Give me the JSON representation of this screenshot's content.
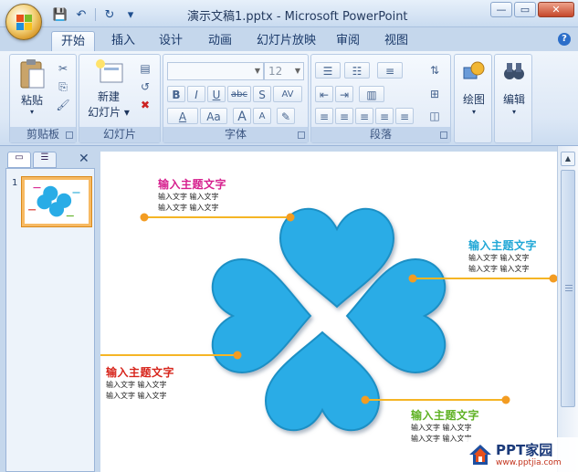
{
  "window": {
    "title": "演示文稿1.pptx - Microsoft PowerPoint",
    "buttons": {
      "minimize": "—",
      "restore": "▭",
      "close": "✕"
    }
  },
  "qat": {
    "save": "💾",
    "undo": "↶",
    "redo": "↻",
    "more": "▾"
  },
  "tabs": [
    "开始",
    "插入",
    "设计",
    "动画",
    "幻灯片放映",
    "审阅",
    "视图"
  ],
  "help": "?",
  "ribbon": {
    "clipboard": {
      "label": "剪贴板",
      "paste": "粘贴",
      "paste_arrow": "▾",
      "cut": "✂",
      "copy": "⎘",
      "format_painter": "🖌"
    },
    "slides": {
      "label": "幻灯片",
      "new_slide_1": "新建",
      "new_slide_2": "幻灯片 ▾",
      "layout": "▤",
      "reset": "↺",
      "delete": "✖"
    },
    "font": {
      "label": "字体",
      "font_name": "",
      "font_size": "12",
      "bold": "B",
      "italic": "I",
      "underline": "U",
      "strike": "abc",
      "shadow": "S",
      "spacing": "AV",
      "font_color": "A",
      "change_case": "Aa",
      "grow": "A",
      "shrink": "A",
      "clear": "✎"
    },
    "paragraph": {
      "label": "段落",
      "bullets": "☰",
      "numbering": "☷",
      "line_spacing": "≡",
      "direction": "⇅",
      "dec_indent": "⇤",
      "inc_indent": "⇥",
      "columns": "▥",
      "align_left": "≡",
      "center": "≡",
      "align_right": "≡",
      "justify": "≡",
      "distribute": "≡",
      "align_text": "⊞",
      "smartart": "◫"
    },
    "drawing": {
      "label": "绘图",
      "arrow": "▾"
    },
    "editing": {
      "label": "编辑",
      "arrow": "▾"
    }
  },
  "panel": {
    "tab1": "▭",
    "tab2": "☰",
    "close": "✕",
    "slide_number": "1"
  },
  "slide": {
    "colors": {
      "heart": "#29ace6",
      "line": "#f5b525",
      "dot": "#f39c22"
    },
    "callouts": [
      {
        "title": "输入主题文字",
        "color": "#d61f8e",
        "line1": "输入文字  输入文字",
        "line2": "输入文字  输入文字"
      },
      {
        "title": "输入主题文字",
        "color": "#20a7d6",
        "line1": "输入文字  输入文字",
        "line2": "输入文字  输入文字"
      },
      {
        "title": "输入主题文字",
        "color": "#d7251c",
        "line1": "输入文字  输入文字",
        "line2": "输入文字  输入文字"
      },
      {
        "title": "输入主题文字",
        "color": "#5fb224",
        "line1": "输入文字  输入文字",
        "line2": "输入文字  输入文字"
      }
    ]
  },
  "watermark": {
    "brand": "PPT家园",
    "url": "www.pptjia.com"
  }
}
